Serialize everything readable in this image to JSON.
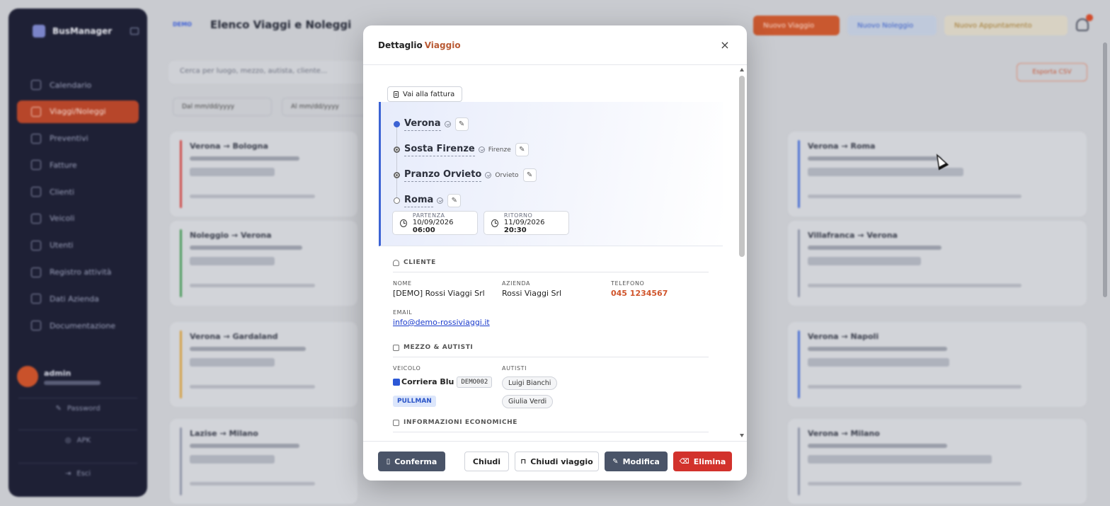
{
  "background": {
    "sidebar": {
      "brand": "BusManager",
      "items": [
        "Calendario",
        "Viaggi/Noleggi",
        "Preventivi",
        "Fatture",
        "Clienti",
        "Veicoli",
        "Utenti",
        "Registro attività",
        "Dati Azienda",
        "Documentazione"
      ],
      "active_index": 1,
      "user_name": "admin",
      "buttons": [
        "Password",
        "APK",
        "Esci"
      ]
    },
    "header": {
      "badge": "DEMO",
      "title": "Elenco Viaggi e Noleggi",
      "btn_new_trip": "Nuovo Viaggio",
      "btn_new_rental": "Nuovo Noleggio",
      "btn_new_appointment": "Nuovo Appuntamento"
    },
    "search_placeholder": "Cerca per luogo, mezzo, autista, cliente...",
    "export_label": "Esporta CSV",
    "date_from": "Dal  mm/dd/yyyy",
    "date_to": "Al  mm/dd/yyyy",
    "cards": [
      {
        "title": "Verona → Bologna",
        "color": "#cf4b48"
      },
      {
        "title": "Noleggio → Verona",
        "color": "#4a9a5b"
      },
      {
        "title": "Verona → Gardaland",
        "color": "#d5a043"
      },
      {
        "title": "Lazise → Milano",
        "color": "#8f95a8"
      },
      {
        "title": "Verona → Roma",
        "color": "#4a6fd3"
      },
      {
        "title": "Villafranca → Verona",
        "color": "#8f95a8"
      },
      {
        "title": "Verona → Napoli",
        "color": "#4a6fd3"
      },
      {
        "title": "Verona → Milano",
        "color": "#8f95a8"
      }
    ]
  },
  "modal": {
    "title_prefix": "Dettaglio",
    "title_accent": "Viaggio",
    "close_symbol": "×",
    "invoice_button": "Vai alla fattura",
    "route": {
      "stops": [
        {
          "name": "Verona",
          "city": "",
          "type": "start"
        },
        {
          "name": "Sosta Firenze",
          "city": "Firenze",
          "type": "mid"
        },
        {
          "name": "Pranzo Orvieto",
          "city": "Orvieto",
          "type": "mid"
        },
        {
          "name": "Roma",
          "city": "",
          "type": "end"
        }
      ],
      "departure_label": "PARTENZA",
      "departure_date": "10/09/2026",
      "departure_time": "06:00",
      "return_label": "RITORNO",
      "return_date": "11/09/2026",
      "return_time": "20:30"
    },
    "client": {
      "section_title": "CLIENTE",
      "name_label": "NOME",
      "name": "[DEMO] Rossi Viaggi Srl",
      "company_label": "AZIENDA",
      "company": "Rossi Viaggi Srl",
      "phone_label": "TELEFONO",
      "phone": "045 1234567",
      "email_label": "EMAIL",
      "email": "info@demo-rossiviaggi.it"
    },
    "vehicle": {
      "section_title": "MEZZO & AUTISTI",
      "vehicle_label": "VEICOLO",
      "vehicle_name": "Corriera Blu",
      "vehicle_color": "#2c58d6",
      "plate": "DEMO002",
      "type": "PULLMAN",
      "drivers_label": "AUTISTI",
      "drivers": [
        "Luigi Bianchi",
        "Giulia Verdi"
      ]
    },
    "economic_section_title": "INFORMAZIONI ECONOMICHE",
    "footer": {
      "confirm": "Conferma",
      "close": "Chiudi",
      "close_trip": "Chiudi viaggio",
      "edit": "Modifica",
      "delete": "Elimina"
    }
  }
}
